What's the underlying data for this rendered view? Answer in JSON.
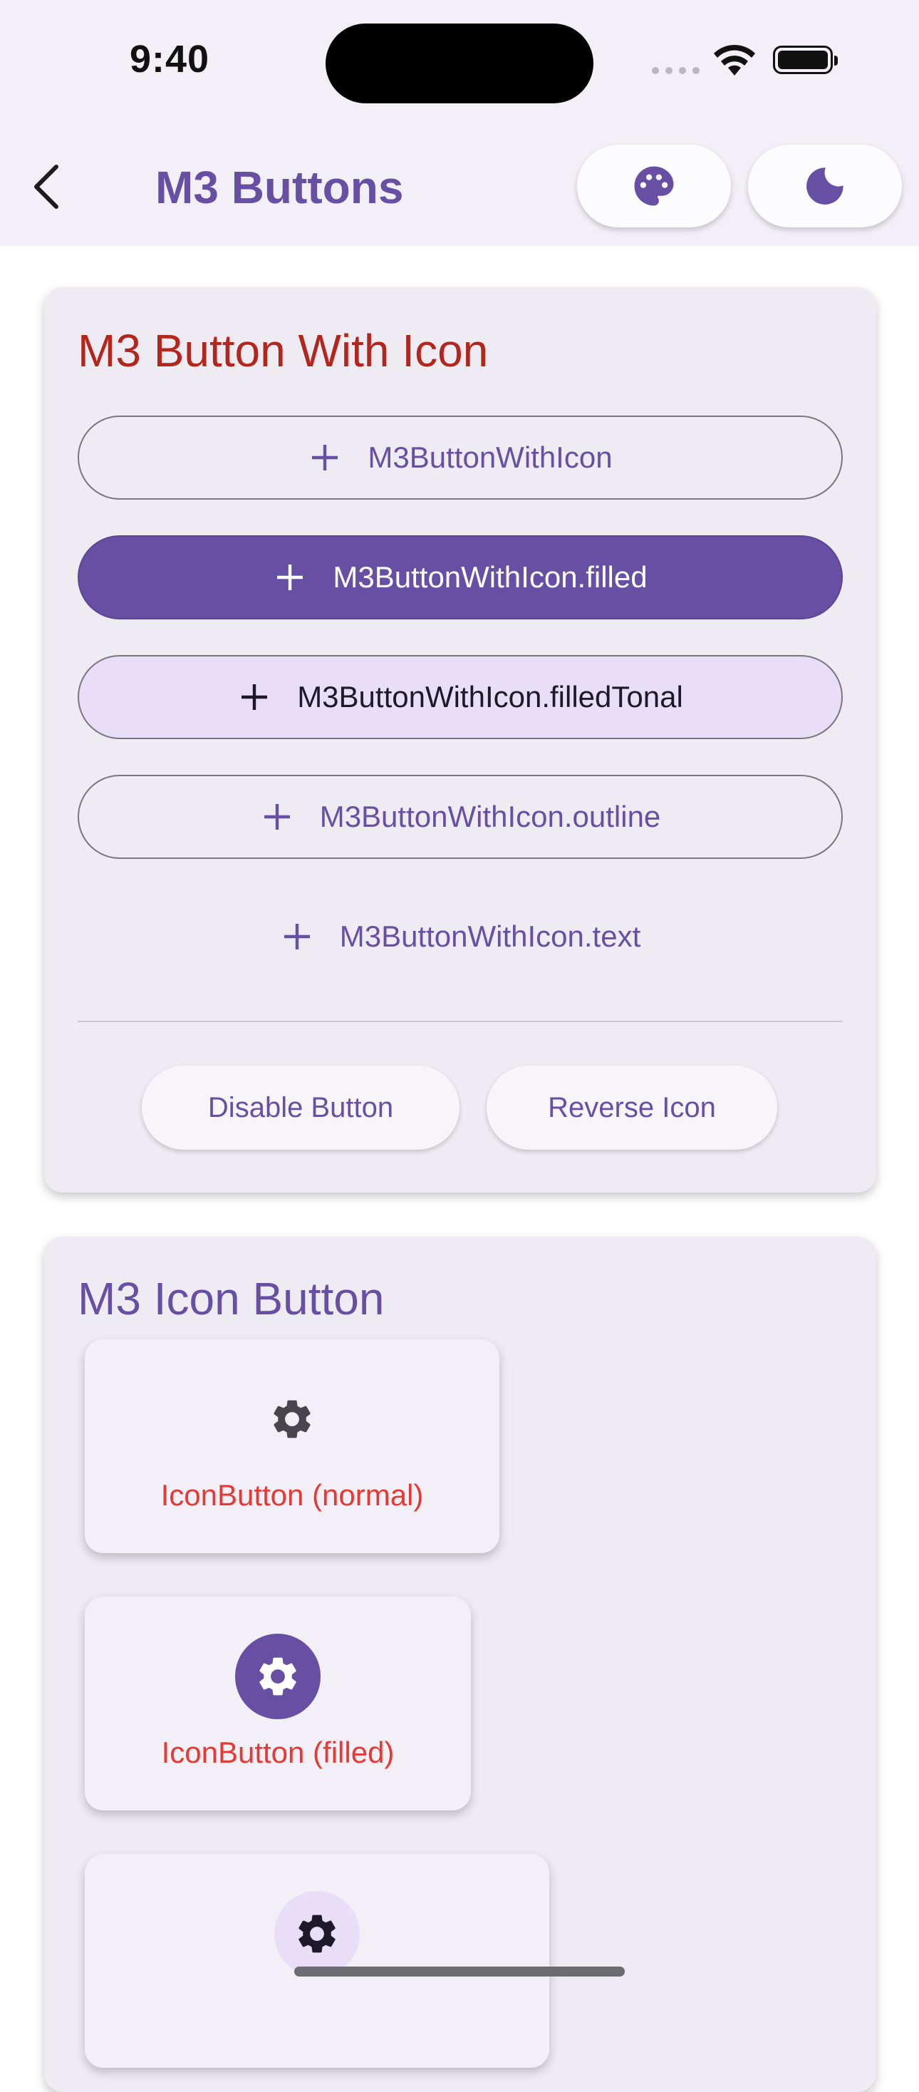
{
  "status_bar": {
    "time": "9:40"
  },
  "app_bar": {
    "title": "M3 Buttons",
    "back_icon": "chevron-left-icon",
    "actions": [
      {
        "name": "palette",
        "icon": "palette-icon"
      },
      {
        "name": "theme",
        "icon": "moon-icon"
      }
    ]
  },
  "colors": {
    "primary": "#6750a4",
    "error_title": "#b3261e",
    "label_red": "#e53935",
    "tonal": "#e8def8",
    "surface": "#efebf3"
  },
  "button_with_icon_card": {
    "title": "M3 Button With Icon",
    "buttons": [
      {
        "label": "M3ButtonWithIcon",
        "icon": "plus-icon"
      },
      {
        "label": "M3ButtonWithIcon.filled",
        "icon": "plus-icon"
      },
      {
        "label": "M3ButtonWithIcon.filledTonal",
        "icon": "plus-icon"
      },
      {
        "label": "M3ButtonWithIcon.outline",
        "icon": "plus-icon"
      },
      {
        "label": "M3ButtonWithIcon.text",
        "icon": "plus-icon"
      }
    ],
    "controls": {
      "disable_label": "Disable Button",
      "reverse_label": "Reverse Icon"
    }
  },
  "icon_button_card": {
    "title": "M3 Icon Button",
    "items": [
      {
        "label": "IconButton (normal)",
        "icon": "gear-icon"
      },
      {
        "label": "IconButton (filled)",
        "icon": "gear-icon"
      },
      {
        "label": "",
        "icon": "gear-icon"
      }
    ]
  }
}
